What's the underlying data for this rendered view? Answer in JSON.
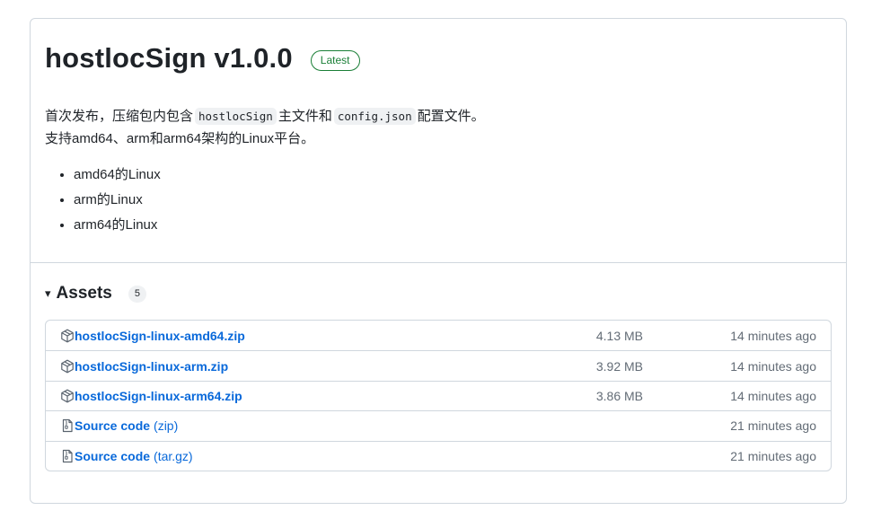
{
  "release": {
    "title": "hostlocSign v1.0.0",
    "badge": "Latest",
    "desc_line1_pre": "首次发布，压缩包内包含",
    "desc_code1": "hostlocSign",
    "desc_line1_mid": "主文件和",
    "desc_code2": "config.json",
    "desc_line1_post": "配置文件。",
    "desc_line2": "支持amd64、arm和arm64架构的Linux平台。",
    "platforms": [
      "amd64的Linux",
      "arm的Linux",
      "arm64的Linux"
    ]
  },
  "assets": {
    "caret": "▾",
    "title": "Assets",
    "count": "5",
    "items": [
      {
        "name": "hostlocSign-linux-amd64.zip",
        "ext": "",
        "size": "4.13 MB",
        "time": "14 minutes ago",
        "icon": "package-icon"
      },
      {
        "name": "hostlocSign-linux-arm.zip",
        "ext": "",
        "size": "3.92 MB",
        "time": "14 minutes ago",
        "icon": "package-icon"
      },
      {
        "name": "hostlocSign-linux-arm64.zip",
        "ext": "",
        "size": "3.86 MB",
        "time": "14 minutes ago",
        "icon": "package-icon"
      },
      {
        "name": "Source code",
        "ext": "(zip)",
        "size": "",
        "time": "21 minutes ago",
        "icon": "file-zip-icon"
      },
      {
        "name": "Source code",
        "ext": "(tar.gz)",
        "size": "",
        "time": "21 minutes ago",
        "icon": "file-zip-icon"
      }
    ]
  },
  "colors": {
    "link": "#0969da",
    "badge_green": "#1a7f37",
    "muted": "#636c76",
    "border": "#d0d7de"
  }
}
